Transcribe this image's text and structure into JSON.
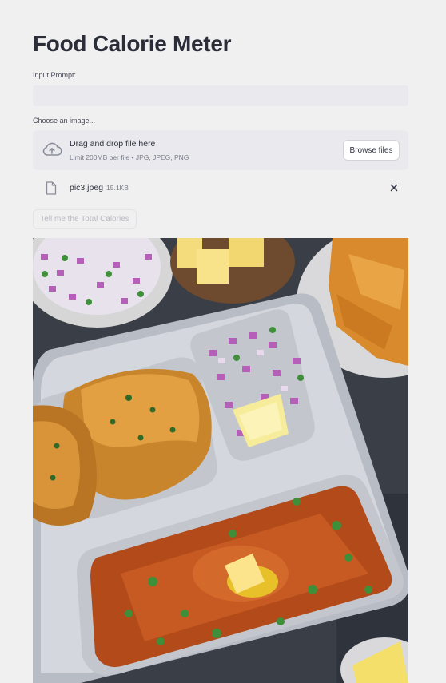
{
  "app": {
    "title": "Food Calorie Meter"
  },
  "prompt": {
    "label": "Input Prompt:",
    "value": ""
  },
  "uploader": {
    "label": "Choose an image...",
    "drop_title": "Drag and drop file here",
    "drop_limit": "Limit 200MB per file • JPG, JPEG, PNG",
    "browse_label": "Browse files",
    "icon": "cloud-upload-icon"
  },
  "uploaded_file": {
    "name": "pic3.jpeg",
    "size": "15.1KB",
    "icon": "file-icon",
    "remove_icon": "close-icon"
  },
  "actions": {
    "submit_label": "Tell me the Total Calories"
  },
  "colors": {
    "background": "#f0f0f1",
    "input_bg": "#e9e9ee",
    "text": "#31333f"
  }
}
